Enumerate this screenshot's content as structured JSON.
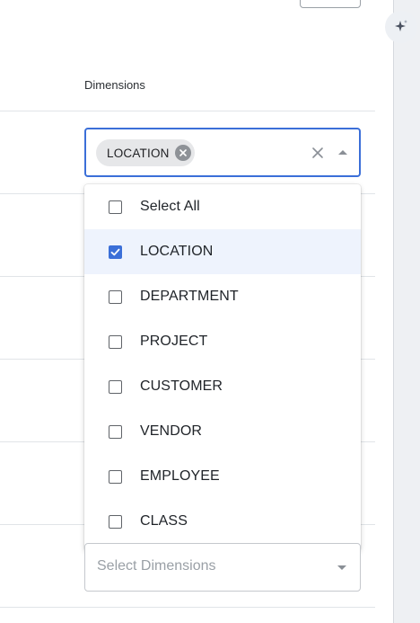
{
  "column_header": "Dimensions",
  "open_select": {
    "chip": "LOCATION",
    "options": [
      {
        "label": "Select All",
        "checked": false
      },
      {
        "label": "LOCATION",
        "checked": true
      },
      {
        "label": "DEPARTMENT",
        "checked": false
      },
      {
        "label": "PROJECT",
        "checked": false
      },
      {
        "label": "CUSTOMER",
        "checked": false
      },
      {
        "label": "VENDOR",
        "checked": false
      },
      {
        "label": "EMPLOYEE",
        "checked": false
      },
      {
        "label": "CLASS",
        "checked": false
      }
    ]
  },
  "closed_select": {
    "placeholder": "Select Dimensions"
  },
  "colors": {
    "accent": "#3b6fd8",
    "selected_row": "#eef3fd",
    "chip_bg": "#e6e7e9"
  },
  "icons": {
    "ai": "sparkle-icon",
    "chip_remove": "close-circle-icon",
    "clear": "close-icon",
    "open_caret": "caret-up-icon",
    "closed_caret": "caret-down-icon"
  }
}
